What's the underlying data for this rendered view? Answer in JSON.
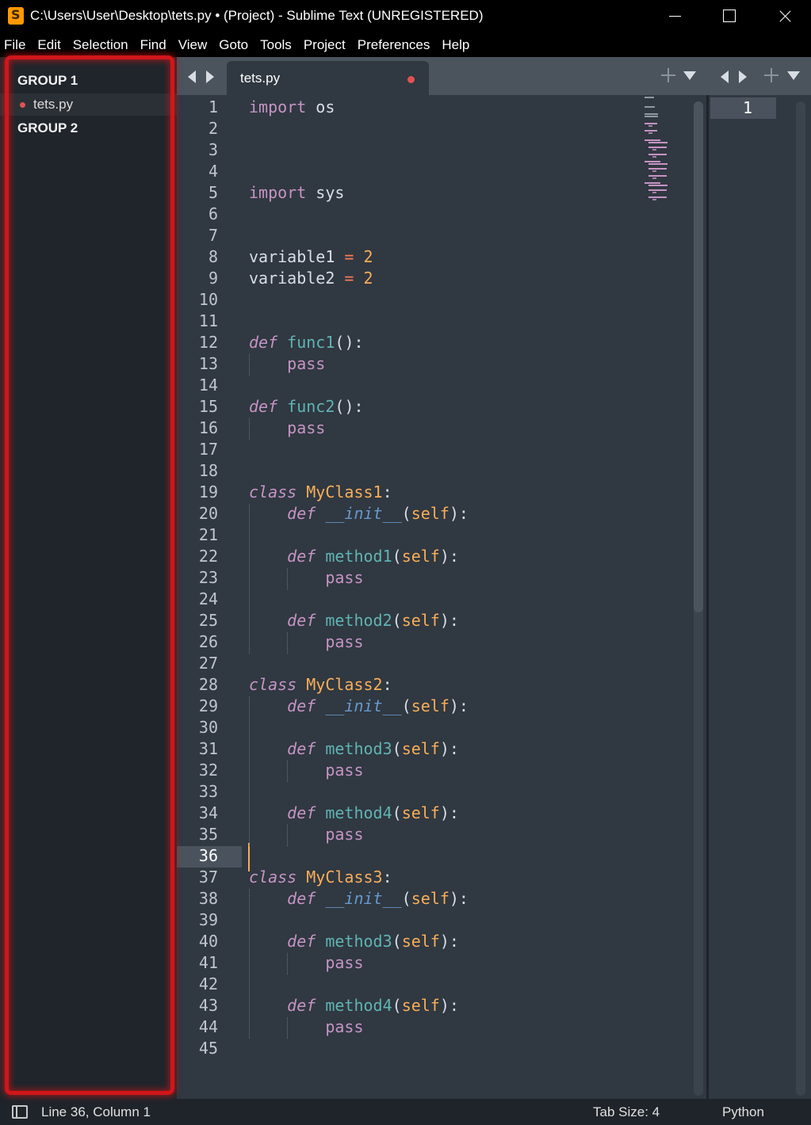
{
  "window": {
    "title": "C:\\Users\\User\\Desktop\\tets.py • (Project) - Sublime Text (UNREGISTERED)"
  },
  "menu": [
    "File",
    "Edit",
    "Selection",
    "Find",
    "View",
    "Goto",
    "Tools",
    "Project",
    "Preferences",
    "Help"
  ],
  "sidebar": {
    "groups": [
      {
        "label": "GROUP 1",
        "files": [
          {
            "name": "tets.py",
            "modified": true
          }
        ]
      },
      {
        "label": "GROUP 2",
        "files": []
      }
    ]
  },
  "tabs": [
    {
      "label": "tets.py",
      "modified": true
    }
  ],
  "editor": {
    "active_line": 36,
    "lines": [
      "import os",
      "",
      "",
      "",
      "import sys",
      "",
      "",
      "variable1 = 2",
      "variable2 = 2",
      "",
      "",
      "def func1():",
      "    pass",
      "",
      "def func2():",
      "    pass",
      "",
      "",
      "class MyClass1:",
      "    def __init__(self):",
      "",
      "    def method1(self):",
      "        pass",
      "",
      "    def method2(self):",
      "        pass",
      "",
      "class MyClass2:",
      "    def __init__(self):",
      "",
      "    def method3(self):",
      "        pass",
      "",
      "    def method4(self):",
      "        pass",
      "",
      "class MyClass3:",
      "    def __init__(self):",
      "",
      "    def method3(self):",
      "        pass",
      "",
      "    def method4(self):",
      "        pass",
      ""
    ]
  },
  "right_pane": {
    "line_numbers": [
      "1"
    ]
  },
  "statusbar": {
    "position": "Line 36, Column 1",
    "tab_size": "Tab Size: 4",
    "syntax": "Python"
  },
  "colors": {
    "background": "#303841",
    "sidebar": "#20252b",
    "highlight_border": "#d1161a",
    "keyword": "#c594c5",
    "function": "#5fb4b4",
    "class_name": "#f9ae58",
    "number": "#f9ae58",
    "operator": "#f97b58",
    "magic_method": "#6699cc",
    "modified_dot": "#e05252"
  }
}
